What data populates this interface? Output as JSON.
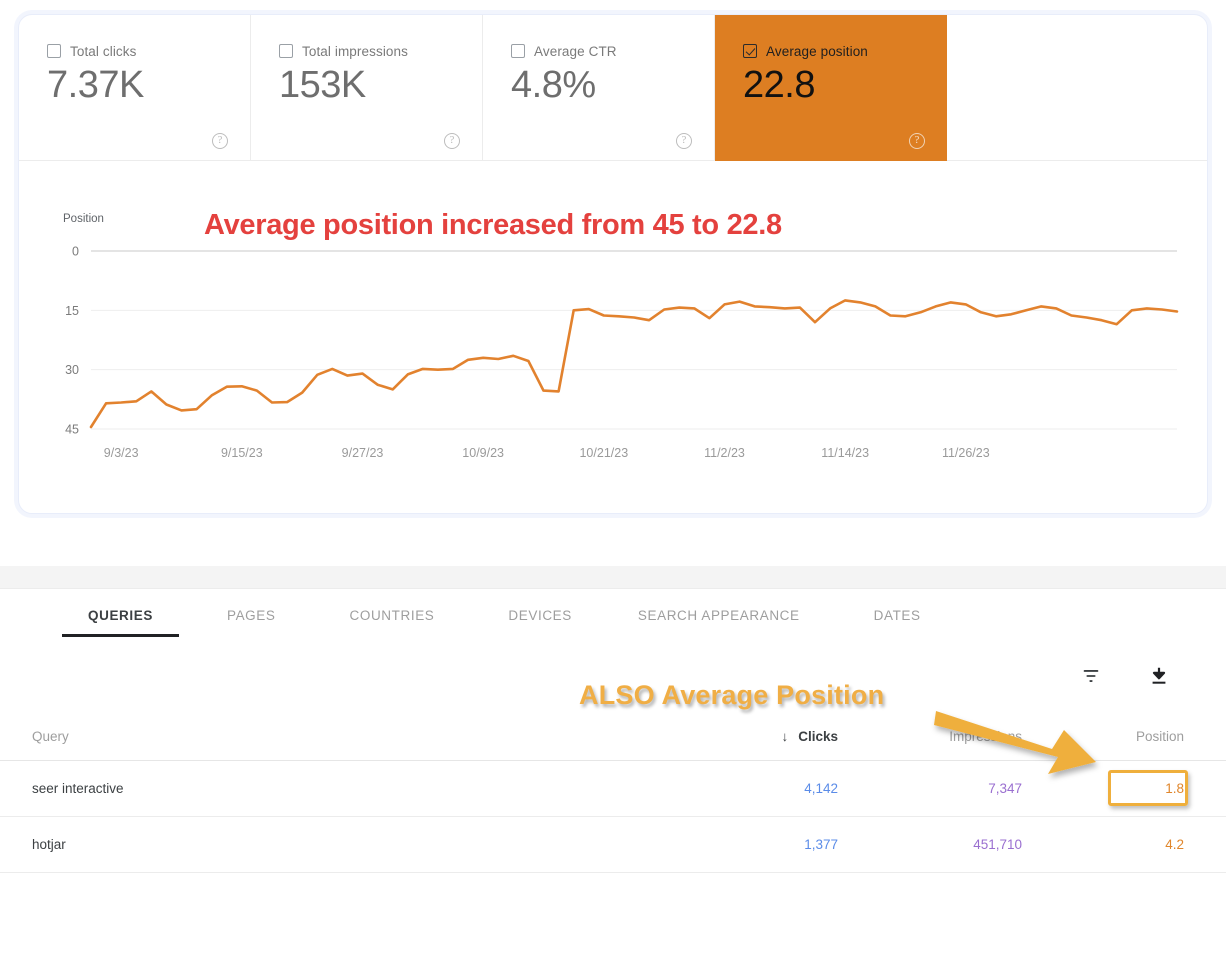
{
  "metrics": [
    {
      "label": "Total clicks",
      "value": "7.37K",
      "checked": false,
      "help": "help-icon"
    },
    {
      "label": "Total impressions",
      "value": "153K",
      "checked": false,
      "help": "help-icon"
    },
    {
      "label": "Average CTR",
      "value": "4.8%",
      "checked": false,
      "help": "help-icon"
    },
    {
      "label": "Average position",
      "value": "22.8",
      "checked": true,
      "help": "help-icon"
    }
  ],
  "chart_annotation": "Average position increased from 45 to 22.8",
  "table_annotation": "ALSO Average Position",
  "colors": {
    "selected_metric_bg": "#dd7e22",
    "line": "#e2822e",
    "annotation_red": "#e4413e",
    "annotation_gold": "#f0ae45",
    "arrow": "#efaf3c",
    "clicks": "#5b8ce8",
    "impressions": "#9a6fd0",
    "position": "#e0862b"
  },
  "chart_data": {
    "type": "line",
    "title": "Average position increased from 45 to 22.8",
    "xlabel": "",
    "ylabel": "Position",
    "ylim": [
      0,
      45
    ],
    "y_inverted": true,
    "yticks": [
      0,
      15,
      30,
      45
    ],
    "grid": true,
    "legend": null,
    "xticks": [
      "9/3/23",
      "9/15/23",
      "9/27/23",
      "10/9/23",
      "10/21/23",
      "11/2/23",
      "11/14/23",
      "11/26/23"
    ],
    "series": [
      {
        "name": "Average position",
        "color": "#e2822e",
        "values": [
          44.5,
          38.5,
          38.3,
          38.0,
          35.5,
          38.8,
          40.3,
          40.0,
          36.5,
          34.3,
          34.2,
          35.3,
          38.3,
          38.2,
          35.8,
          31.3,
          29.8,
          31.5,
          31.0,
          33.8,
          35.0,
          31.2,
          29.8,
          30.0,
          29.8,
          27.5,
          27.0,
          27.3,
          26.5,
          27.8,
          35.3,
          35.5,
          15.0,
          14.7,
          16.3,
          16.5,
          16.8,
          17.5,
          14.8,
          14.3,
          14.5,
          17.0,
          13.5,
          12.8,
          14.0,
          14.2,
          14.5,
          14.3,
          18.0,
          14.5,
          12.5,
          13.0,
          14.0,
          16.3,
          16.5,
          15.5,
          14.0,
          13.0,
          13.5,
          15.5,
          16.5,
          16.0,
          15.0,
          14.0,
          14.5,
          16.3,
          16.8,
          17.5,
          18.5,
          15.0,
          14.5,
          14.8,
          15.3
        ]
      }
    ]
  },
  "tabs": [
    {
      "label": "QUERIES",
      "active": true
    },
    {
      "label": "PAGES",
      "active": false
    },
    {
      "label": "COUNTRIES",
      "active": false
    },
    {
      "label": "DEVICES",
      "active": false
    },
    {
      "label": "SEARCH APPEARANCE",
      "active": false
    },
    {
      "label": "DATES",
      "active": false
    }
  ],
  "toolbar": {
    "filter_icon": "filter-icon",
    "download_icon": "download-icon"
  },
  "table": {
    "headers": {
      "query": "Query",
      "clicks": "Clicks",
      "impressions": "Impressions",
      "position": "Position",
      "sort_arrow": "↓"
    },
    "rows": [
      {
        "query": "seer interactive",
        "clicks": "4,142",
        "impressions": "7,347",
        "position": "1.8"
      },
      {
        "query": "hotjar",
        "clicks": "1,377",
        "impressions": "451,710",
        "position": "4.2"
      }
    ]
  }
}
